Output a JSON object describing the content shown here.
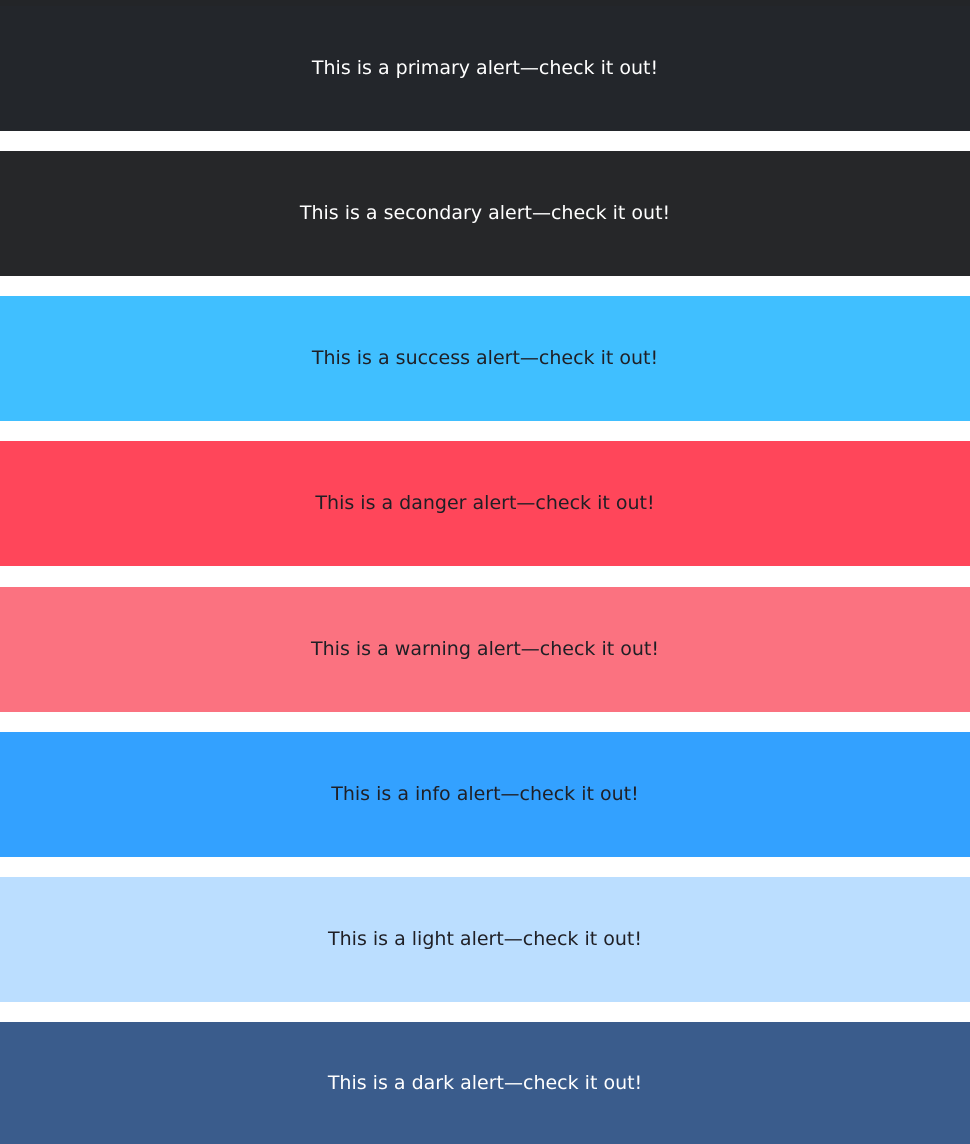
{
  "alerts": [
    {
      "variant": "primary",
      "text": "This is a primary alert—check it out!",
      "bg": "#23262b",
      "fg": "#ffffff"
    },
    {
      "variant": "secondary",
      "text": "This is a secondary alert—check it out!",
      "bg": "#262729",
      "fg": "#ffffff"
    },
    {
      "variant": "success",
      "text": "This is a success alert—check it out!",
      "bg": "#40bfff",
      "fg": "#1f1f25"
    },
    {
      "variant": "danger",
      "text": "This is a danger alert—check it out!",
      "bg": "#ff465a",
      "fg": "#1f1f25"
    },
    {
      "variant": "warning",
      "text": "This is a warning alert—check it out!",
      "bg": "#fb7280",
      "fg": "#1f1f25"
    },
    {
      "variant": "info",
      "text": "This is a info alert—check it out!",
      "bg": "#33a1ff",
      "fg": "#1f1f25"
    },
    {
      "variant": "light",
      "text": "This is a light alert—check it out!",
      "bg": "#bbdeff",
      "fg": "#1f1f25"
    },
    {
      "variant": "dark",
      "text": "This is a dark alert—check it out!",
      "bg": "#3a5c8c",
      "fg": "#ffffff"
    }
  ]
}
